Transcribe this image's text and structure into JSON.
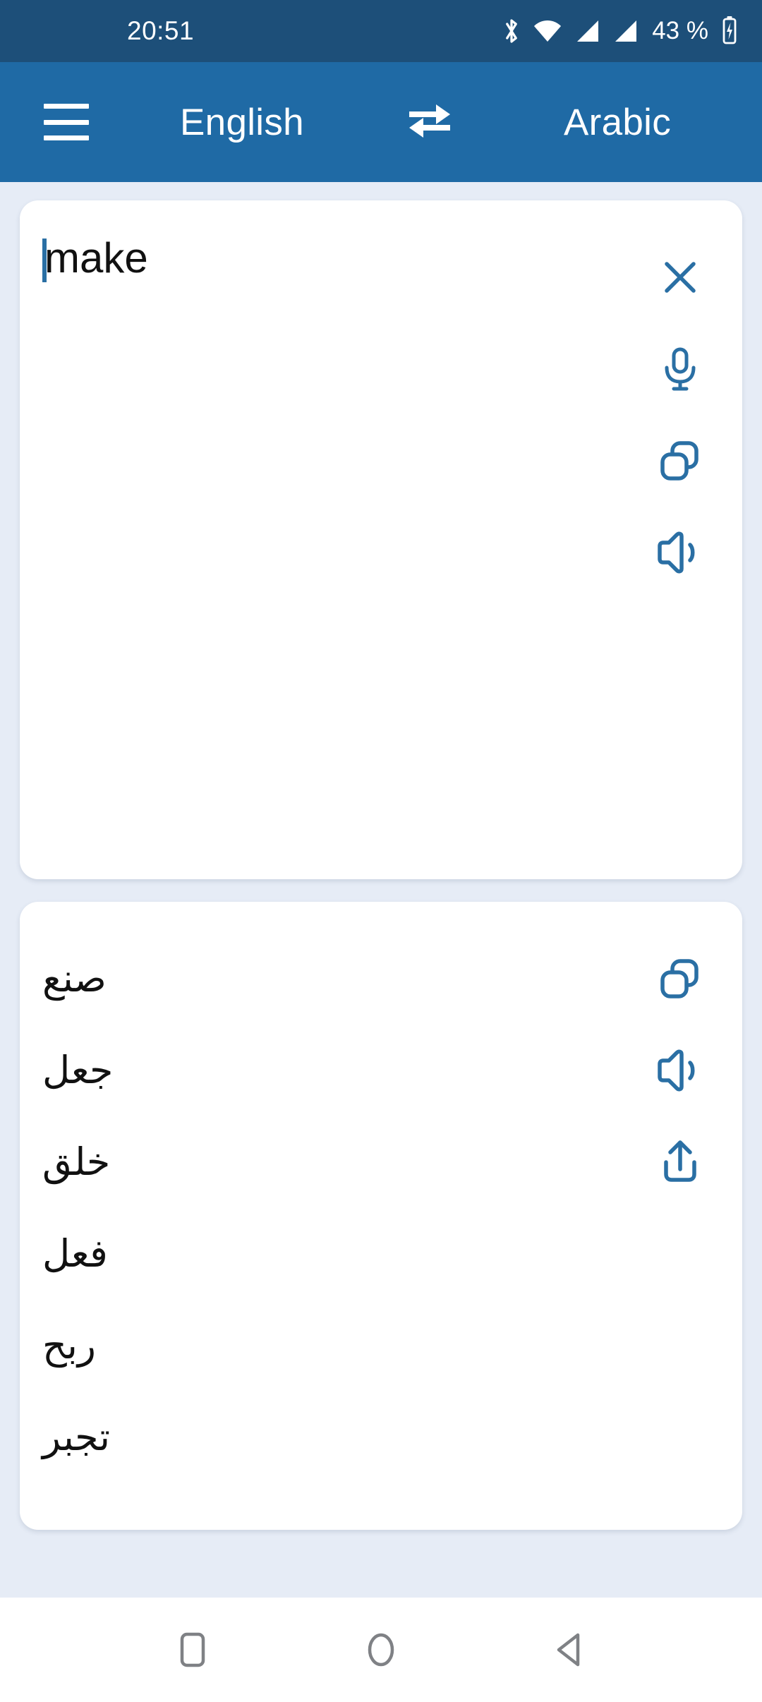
{
  "status_bar": {
    "time": "20:51",
    "battery_text": "43 %",
    "icons": [
      "bluetooth-icon",
      "wifi-icon",
      "signal-sim1-icon",
      "signal-sim2-icon",
      "battery-charging-icon"
    ],
    "background_color": "#1d4f79",
    "foreground_color": "#ffffff"
  },
  "app_bar": {
    "menu_icon": "hamburger-menu-icon",
    "source_language": "English",
    "swap_icon": "swap-horizontal-icon",
    "target_language": "Arabic",
    "background_color": "#1f6aa5",
    "text_color": "#ffffff"
  },
  "theme": {
    "page_background": "#e6ecf6",
    "card_background": "#ffffff",
    "accent_color": "#2a6fa4",
    "text_color": "#111111"
  },
  "input_card": {
    "text": "make",
    "caret_visible": true,
    "actions": [
      {
        "name": "clear-button",
        "icon": "close-icon",
        "label": "Clear"
      },
      {
        "name": "voice-input-button",
        "icon": "microphone-icon",
        "label": "Voice input"
      },
      {
        "name": "copy-input-button",
        "icon": "copy-icon",
        "label": "Copy"
      },
      {
        "name": "speak-input-button",
        "icon": "speaker-icon",
        "label": "Listen"
      }
    ]
  },
  "output_card": {
    "translations": [
      "صنع",
      "جعل",
      "خلق",
      "فعل",
      "ربح",
      "تجبر"
    ],
    "actions": [
      {
        "name": "copy-output-button",
        "icon": "copy-icon",
        "label": "Copy"
      },
      {
        "name": "speak-output-button",
        "icon": "speaker-icon",
        "label": "Listen"
      },
      {
        "name": "share-output-button",
        "icon": "share-icon",
        "label": "Share"
      }
    ]
  },
  "nav_bar": {
    "buttons": [
      {
        "name": "recents-button",
        "icon": "square-icon",
        "label": "Recents"
      },
      {
        "name": "home-button",
        "icon": "circle-icon",
        "label": "Home"
      },
      {
        "name": "back-button",
        "icon": "triangle-left-icon",
        "label": "Back"
      }
    ],
    "background_color": "#ffffff",
    "icon_color": "#7a7a7a"
  }
}
